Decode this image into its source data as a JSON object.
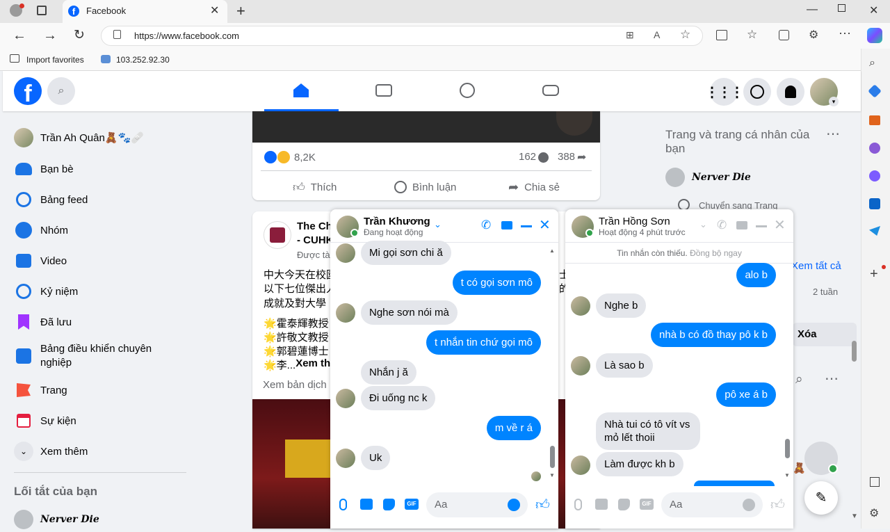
{
  "browser": {
    "tab_title": "Facebook",
    "url": "https://www.facebook.com",
    "fav_import": "Import favorites",
    "fav_ip": "103.252.92.30"
  },
  "left_sidebar": {
    "profile_name": "Trần Ah Quân",
    "profile_emoji": "🧸🐾🩹",
    "items": [
      {
        "label": "Bạn bè",
        "icon": "friends-icon"
      },
      {
        "label": "Bảng feed",
        "icon": "feed-icon"
      },
      {
        "label": "Nhóm",
        "icon": "groups-icon"
      },
      {
        "label": "Video",
        "icon": "video-icon"
      },
      {
        "label": "Kỷ niệm",
        "icon": "memories-icon"
      },
      {
        "label": "Đã lưu",
        "icon": "saved-icon"
      },
      {
        "label": "Bảng điều khiển chuyên nghiệp",
        "icon": "dashboard-icon"
      },
      {
        "label": "Trang",
        "icon": "pages-icon"
      },
      {
        "label": "Sự kiện",
        "icon": "events-icon"
      },
      {
        "label": "Xem thêm",
        "icon": "chevron-down-icon"
      }
    ],
    "shortcuts_title": "Lối tắt của bạn",
    "shortcut_name": "Nerver Die"
  },
  "post1": {
    "reaction_count": "8,2K",
    "comment_count": "162",
    "share_count": "388",
    "like_label": "Thích",
    "comment_label": "Bình luận",
    "share_label": "Chia sẻ"
  },
  "post2": {
    "author_line1": "The Ch",
    "author_line2": "- CUHK",
    "sub": "Được tài",
    "text_lines": [
      "中大今天在校園",
      "以下七位傑出人",
      "成就及對大學"
    ],
    "text_right": [
      "士",
      "的"
    ],
    "list": [
      "🌟霍泰輝教授",
      "🌟許敬文教授",
      "🌟郭碧蓮博士",
      "🌟李... "
    ],
    "see_more": "Xem th",
    "see_translation": "Xem bản dịch"
  },
  "right_panel": {
    "title": "Trang và trang cá nhân của bạn",
    "page_name": "Nerver Die",
    "switch_label": "Chuyển sang Trang",
    "see_all": "Xem tất cả",
    "time": "2 tuần",
    "delete": "Xóa"
  },
  "chat1": {
    "name": "Trần Khương",
    "status": "Đang hoạt động",
    "placeholder": "Aa",
    "messages": [
      {
        "dir": "in",
        "text": "Mi gọi sơn chi ă"
      },
      {
        "dir": "out",
        "text": "t có gọi sơn mô"
      },
      {
        "dir": "in",
        "text": "Nghe sơn nói mà"
      },
      {
        "dir": "out",
        "text": "t nhắn tin chứ gọi mô"
      },
      {
        "dir": "in",
        "text": "Nhắn j ă"
      },
      {
        "dir": "in",
        "text": "Đi uống nc k"
      },
      {
        "dir": "out",
        "text": "m về r á"
      },
      {
        "dir": "in",
        "text": "Uk"
      }
    ]
  },
  "chat2": {
    "name": "Trần Hồng Sơn",
    "status": "Hoạt động 4 phút trước",
    "notice": "Tin nhắn còn thiếu.",
    "sync": "Đồng bộ ngay",
    "placeholder": "Aa",
    "messages": [
      {
        "dir": "out",
        "text": "alo b"
      },
      {
        "dir": "in",
        "text": "Nghe b"
      },
      {
        "dir": "out",
        "text": "nhà b có đồ thay pô k b"
      },
      {
        "dir": "in",
        "text": "Là sao b"
      },
      {
        "dir": "out",
        "text": "pô xe á b"
      },
      {
        "dir": "in",
        "text": "Nhà tui có tô vít vs mỏ lết thoii"
      },
      {
        "dir": "in",
        "text": "Làm được kh b"
      }
    ]
  },
  "colors": {
    "fb_blue": "#0866ff",
    "messenger_blue": "#0084ff",
    "bg": "#f0f2f5"
  }
}
